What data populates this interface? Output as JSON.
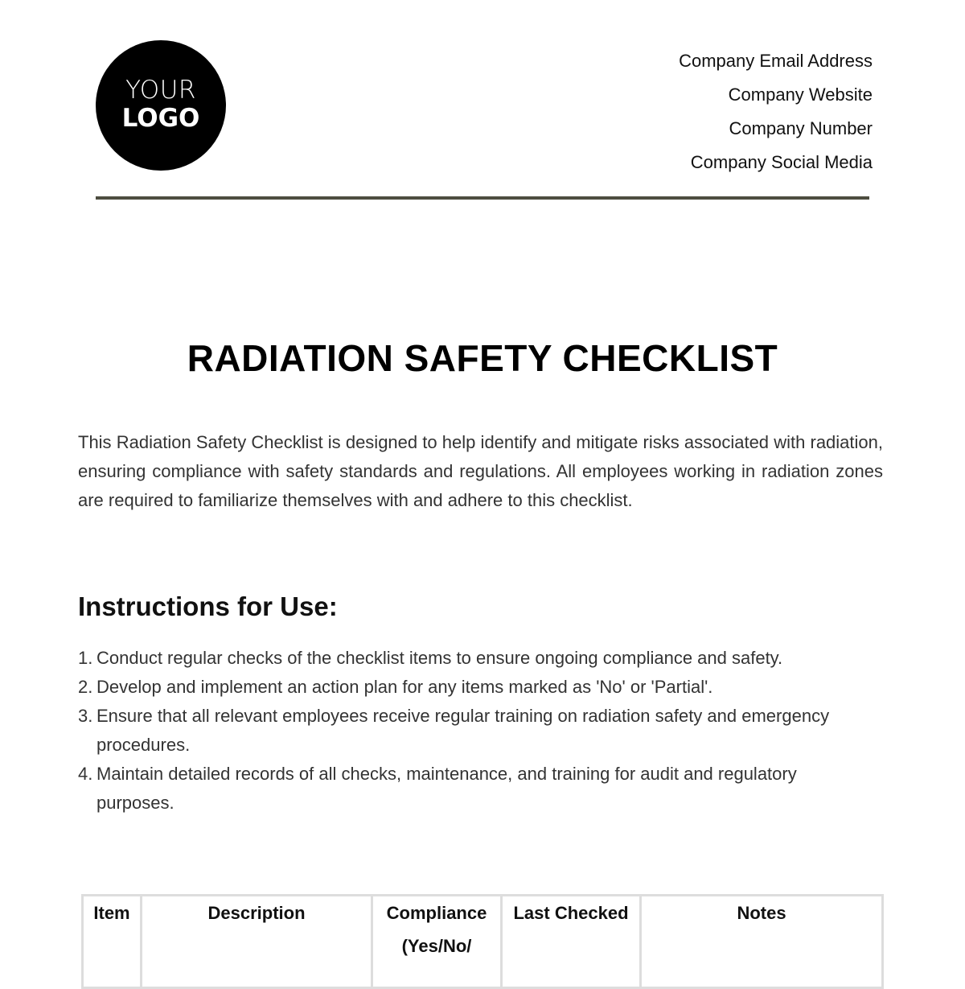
{
  "header": {
    "logo": {
      "line1": "YOUR",
      "line2": "LOGO"
    },
    "contact": [
      "Company Email Address",
      "Company Website",
      "Company Number",
      "Company Social Media"
    ]
  },
  "document": {
    "title": "RADIATION SAFETY CHECKLIST",
    "intro": "This Radiation Safety Checklist is designed to help identify and mitigate risks associated with radiation, ensuring compliance with safety standards and regulations. All employees working in radiation zones are required to familiarize themselves with and adhere to this checklist.",
    "instructions_heading": "Instructions for Use:",
    "instructions": [
      {
        "num": "1.",
        "text": "Conduct regular checks of the checklist items to ensure ongoing compliance and safety."
      },
      {
        "num": "2.",
        "text": "Develop and implement an action plan for any items marked as 'No' or 'Partial'."
      },
      {
        "num": "3.",
        "text": "Ensure that all relevant employees receive regular training on radiation safety and emergency procedures."
      },
      {
        "num": "4.",
        "text": "Maintain detailed records of all checks, maintenance, and training for audit and regulatory purposes."
      }
    ],
    "table": {
      "headers": [
        "Item",
        "Description",
        "Compliance (Yes/No/",
        "Last Checked",
        "Notes"
      ]
    }
  }
}
